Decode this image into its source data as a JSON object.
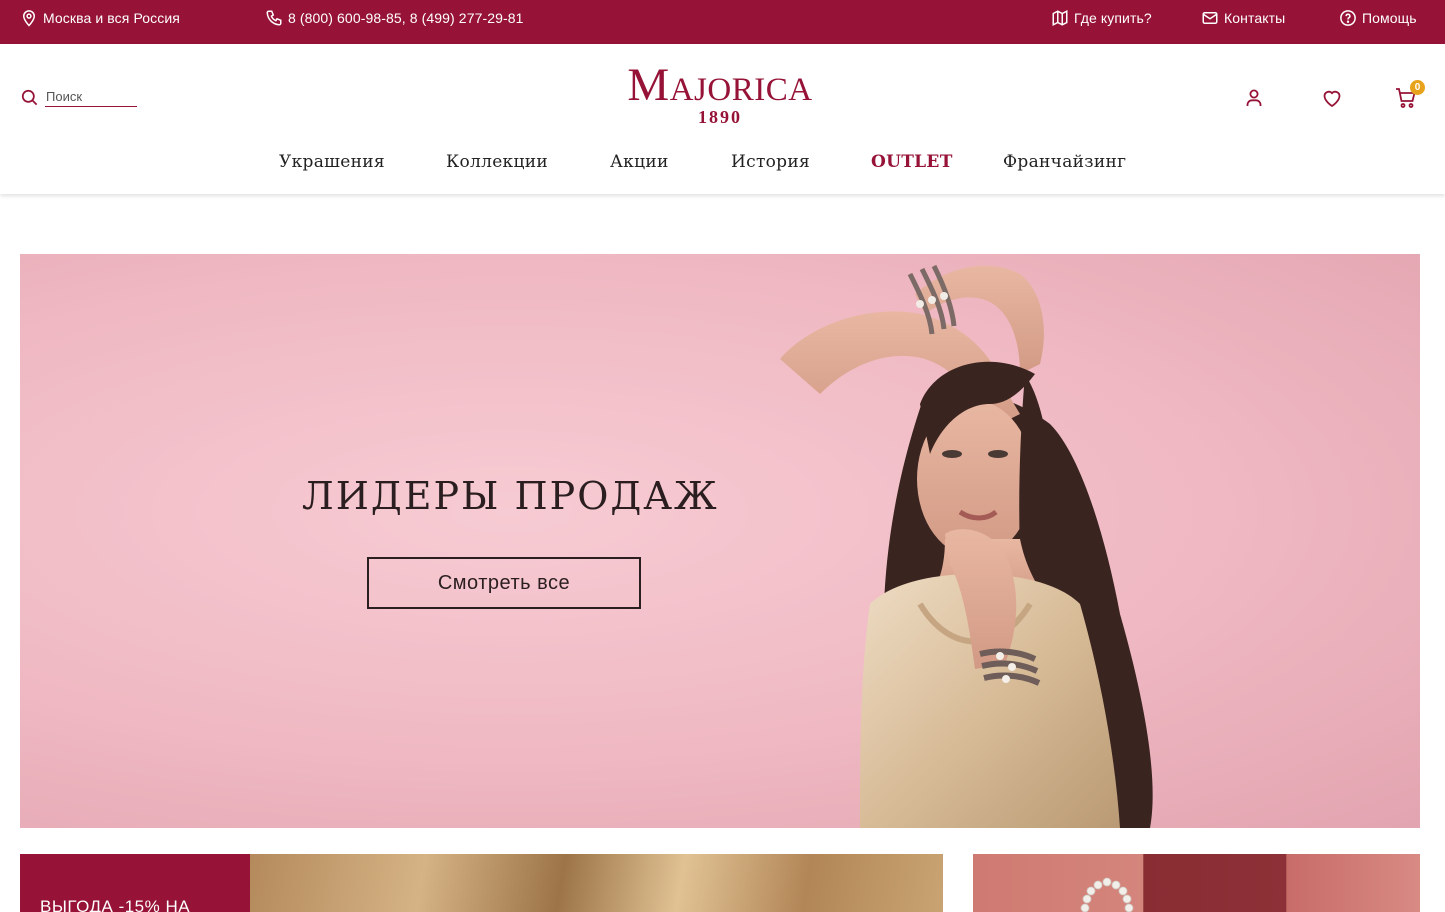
{
  "topbar": {
    "region": "Москва и вся Россия",
    "phones": "8 (800) 600-98-85, 8 (499) 277-29-81",
    "where_to_buy": "Где купить?",
    "contacts": "Контакты",
    "help": "Помощь",
    "icons": [
      "location-pin-icon",
      "phone-icon",
      "map-icon",
      "mail-icon",
      "help-icon"
    ]
  },
  "header": {
    "search_placeholder": "Поиск",
    "logo_text": "Majorica",
    "logo_year": "1890",
    "cart_count": "0",
    "icons": [
      "search-icon",
      "user-icon",
      "heart-icon",
      "cart-icon"
    ]
  },
  "nav": {
    "items": [
      "Украшения",
      "Коллекции",
      "Акции",
      "История",
      "OUTLET",
      "Франчайзинг"
    ]
  },
  "hero": {
    "title": "ЛИДЕРЫ ПРОДАЖ",
    "cta": "Смотреть все"
  },
  "promo": {
    "text": "ВЫГОДА -15% НА"
  },
  "colors": {
    "brand": "#961337",
    "hero_bg": "#efb8c2",
    "badge": "#e8a31c"
  }
}
